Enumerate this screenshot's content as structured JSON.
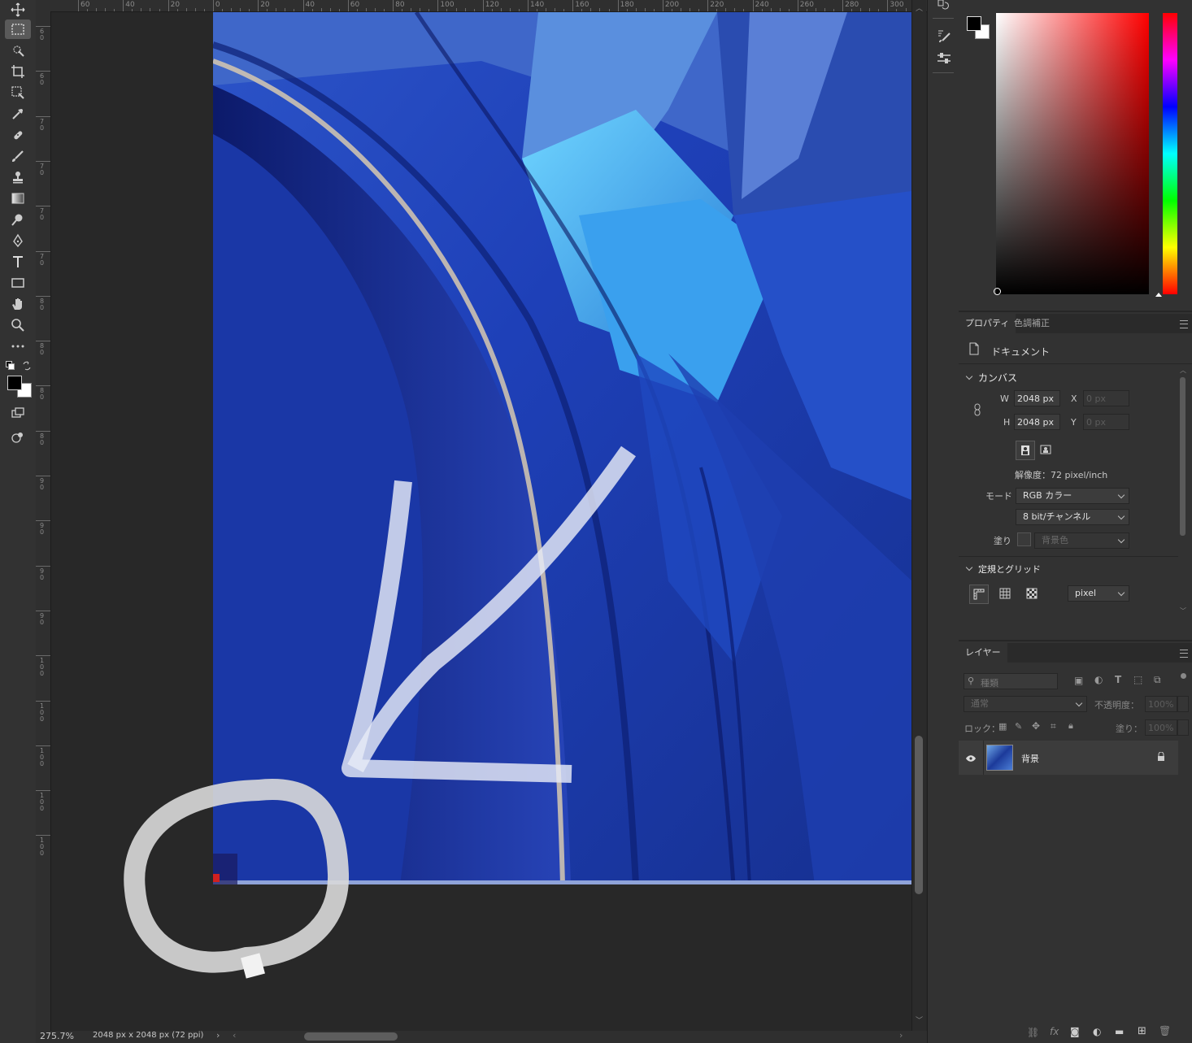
{
  "status": {
    "zoom": "275.7%",
    "doc_info": "2048 px x 2048 px (72 ppi)"
  },
  "ruler": {
    "top_labels": [
      "60",
      "40",
      "20",
      "0",
      "20",
      "40",
      "60",
      "80",
      "100",
      "120",
      "140",
      "160",
      "180",
      "200",
      "220",
      "240",
      "260",
      "280",
      "300"
    ],
    "left_labels": [
      "60",
      "60",
      "70",
      "70",
      "70",
      "70",
      "80",
      "80",
      "80",
      "80",
      "90",
      "90",
      "90",
      "90",
      "100",
      "100",
      "100",
      "100",
      "100"
    ]
  },
  "colors": {
    "foreground": "#000000",
    "background": "#ffffff",
    "accent": "#ff0000"
  },
  "properties": {
    "tabs": [
      {
        "label": "プロパティ",
        "active": true
      },
      {
        "label": "色調補正",
        "active": false
      }
    ],
    "doc_label": "ドキュメント",
    "canvas_section": "カンバス",
    "w_label": "W",
    "w_value": "2048 px",
    "h_label": "H",
    "h_value": "2048 px",
    "x_label": "X",
    "x_value": "0 px",
    "y_label": "Y",
    "y_value": "0 px",
    "resolution": "解像度：72 pixel/inch",
    "mode_label": "モード",
    "mode_value": "RGB カラー",
    "bit_value": "8 bit/チャンネル",
    "fill_label": "塗り",
    "fill_value": "背景色",
    "rulers_section": "定規とグリッド",
    "unit_value": "pixel"
  },
  "layers": {
    "tab_label": "レイヤー",
    "search_placeholder": "種類",
    "blend_mode": "通常",
    "opacity_label": "不透明度：",
    "opacity_value": "100%",
    "lock_label": "ロック：",
    "fill_label": "塗り：",
    "fill_value": "100%",
    "items": [
      {
        "name": "背景",
        "visible": true,
        "locked": true
      }
    ]
  }
}
